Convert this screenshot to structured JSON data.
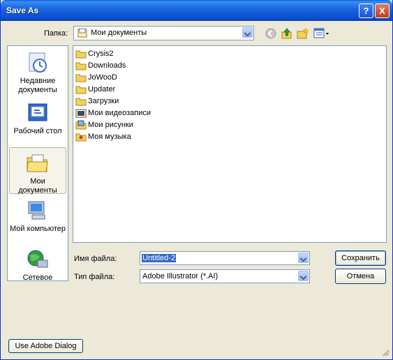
{
  "window": {
    "title": "Save As"
  },
  "titlebar": {
    "help_label": "?",
    "close_label": "X"
  },
  "lookin": {
    "label": "Папка:",
    "value": "Мои документы"
  },
  "toolbar": {
    "icons": [
      "back-icon",
      "up-folder-icon",
      "new-folder-icon",
      "views-menu-icon"
    ]
  },
  "places": [
    {
      "label": "Недавние документы",
      "icon": "recent-documents-icon"
    },
    {
      "label": "Рабочий стол",
      "icon": "desktop-icon"
    },
    {
      "label": "Мои документы",
      "icon": "my-documents-icon",
      "active": true
    },
    {
      "label": "Мой компьютер",
      "icon": "my-computer-icon"
    },
    {
      "label": "Сетевое",
      "icon": "network-icon"
    }
  ],
  "files": [
    {
      "name": "Crysis2",
      "icon": "folder-icon"
    },
    {
      "name": "Downloads",
      "icon": "folder-icon"
    },
    {
      "name": "JoWooD",
      "icon": "folder-icon"
    },
    {
      "name": "Updater",
      "icon": "folder-icon"
    },
    {
      "name": "Загрузки",
      "icon": "folder-icon"
    },
    {
      "name": "Мои видеозаписи",
      "icon": "video-folder-icon"
    },
    {
      "name": "Мои рисунки",
      "icon": "pictures-folder-icon"
    },
    {
      "name": "Моя музыка",
      "icon": "music-folder-icon"
    }
  ],
  "filename": {
    "label": "Имя файла:",
    "value": "Untitled-2"
  },
  "filetype": {
    "label": "Тип файла:",
    "value": "Adobe Illustrator (*.AI)"
  },
  "buttons": {
    "save": "Сохранить",
    "cancel": "Отмена",
    "adobe": "Use Adobe Dialog"
  },
  "colors": {
    "title_blue": "#0a4fd0",
    "dialog_bg": "#ece9d8",
    "selection": "#316ac5"
  }
}
